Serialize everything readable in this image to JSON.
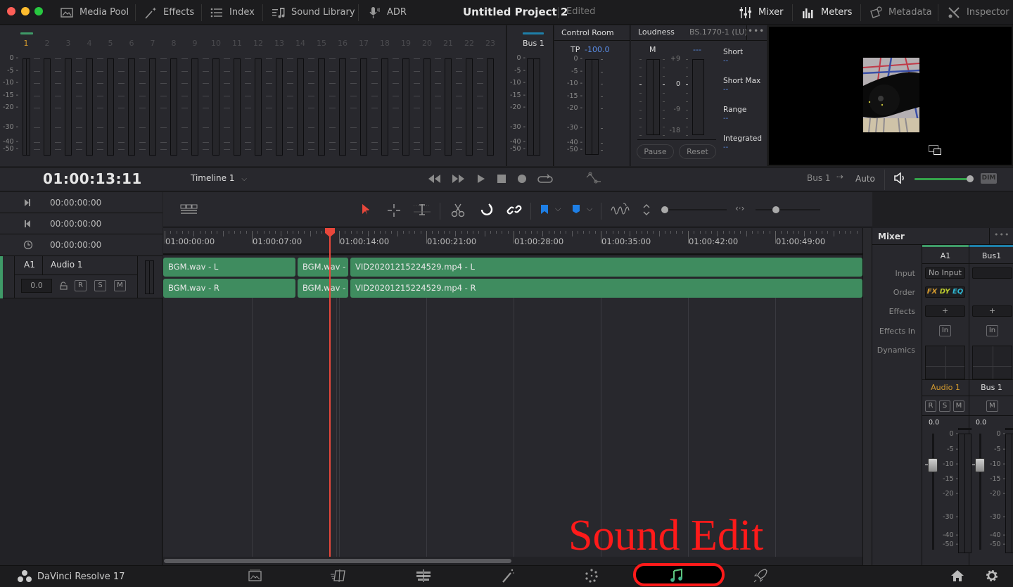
{
  "window": {
    "project_title": "Untitled Project 2",
    "project_status": "Edited",
    "traffic_colors": {
      "close": "#fe5f57",
      "minimize": "#febc2e",
      "maximize": "#28c840"
    }
  },
  "top_toolbar": {
    "left": [
      {
        "label": "Media Pool",
        "icon": "media-pool-icon"
      },
      {
        "label": "Effects",
        "icon": "effects-wand-icon"
      },
      {
        "label": "Index",
        "icon": "index-list-icon"
      },
      {
        "label": "Sound Library",
        "icon": "sound-library-icon"
      },
      {
        "label": "ADR",
        "icon": "microphone-icon"
      }
    ],
    "right": [
      {
        "label": "Mixer",
        "icon": "mixer-icon",
        "active": true
      },
      {
        "label": "Meters",
        "icon": "meters-icon",
        "active": true
      },
      {
        "label": "Metadata",
        "icon": "metadata-icon",
        "active": false
      },
      {
        "label": "Inspector",
        "icon": "inspector-icon",
        "active": false
      }
    ]
  },
  "meters": {
    "channels": [
      "1",
      "2",
      "3",
      "4",
      "5",
      "6",
      "7",
      "8",
      "9",
      "10",
      "11",
      "12",
      "13",
      "14",
      "15",
      "16",
      "17",
      "18",
      "19",
      "20",
      "21",
      "22",
      "23"
    ],
    "active_channel": "1",
    "scale": [
      "0",
      "-5",
      "-10",
      "-15",
      "-20",
      "-30",
      "-40",
      "-50"
    ],
    "bus_label": "Bus 1"
  },
  "control_room": {
    "title": "Control Room",
    "tp_label": "TP",
    "tp_value": "-100.0",
    "scale": [
      "0",
      "-5",
      "-10",
      "-15",
      "-20",
      "-30",
      "-40",
      "-50"
    ]
  },
  "loudness": {
    "title": "Loudness",
    "standard": "BS.1770-1 (LU)",
    "m_label": "M",
    "m_value": "---",
    "scale": [
      "+9",
      "0",
      "-9",
      "-18"
    ],
    "stats": [
      {
        "label": "Short",
        "value": "--"
      },
      {
        "label": "Short Max",
        "value": "--"
      },
      {
        "label": "Range",
        "value": "--"
      },
      {
        "label": "Integrated",
        "value": "--"
      }
    ],
    "pause_label": "Pause",
    "reset_label": "Reset"
  },
  "transport": {
    "timecode": "01:00:13:11",
    "timeline_name": "Timeline 1",
    "bus_route_from": "Bus 1",
    "bus_route_to": "Auto",
    "dim_label": "DIM",
    "volume_level": 1.0
  },
  "timecode_fields": [
    {
      "icon": "in-point-icon",
      "value": "00:00:00:00"
    },
    {
      "icon": "out-point-icon",
      "value": "00:00:00:00"
    },
    {
      "icon": "duration-clock-icon",
      "value": "00:00:00:00"
    }
  ],
  "track": {
    "id": "A1",
    "name": "Audio 1",
    "level": "0.0",
    "buttons": [
      "R",
      "S",
      "M"
    ]
  },
  "ruler": {
    "labels": [
      "01:00:00:00",
      "01:00:07:00",
      "01:00:14:00",
      "01:00:21:00",
      "01:00:28:00",
      "01:00:35:00",
      "01:00:42:00",
      "01:00:49:00"
    ]
  },
  "clips": {
    "left": [
      "BGM.wav - L",
      "BGM.wav - L",
      "VID20201215224529.mp4 - L"
    ],
    "right": [
      "BGM.wav - R",
      "BGM.wav - R",
      "VID20201215224529.mp4 - R"
    ]
  },
  "mixer": {
    "title": "Mixer",
    "columns": [
      "A1",
      "Bus1"
    ],
    "row_labels": [
      "Input",
      "Order",
      "Effects",
      "Effects In",
      "Dynamics"
    ],
    "input_value": "No Input",
    "order": [
      "FX",
      "DY",
      "EQ"
    ],
    "add_label": "+",
    "in_label": "In",
    "strip_names": [
      "Audio 1",
      "Bus 1"
    ],
    "strip_buttons_a1": [
      "R",
      "S",
      "M"
    ],
    "strip_buttons_bus": [
      "M"
    ],
    "fader_values": [
      "0.0",
      "0.0"
    ],
    "scale": [
      "0",
      "-5",
      "-10",
      "-15",
      "-20",
      "-30",
      "-40",
      "-50"
    ]
  },
  "bottom": {
    "app_name": "DaVinci Resolve 17",
    "pages": [
      "media-page-icon",
      "cut-page-icon",
      "edit-page-icon",
      "fusion-page-icon",
      "color-page-icon",
      "fairlight-page-icon",
      "deliver-page-icon"
    ],
    "active_page": "fairlight-page-icon"
  },
  "annotation": {
    "text": "Sound Edit",
    "color": "#ff1a1a"
  }
}
